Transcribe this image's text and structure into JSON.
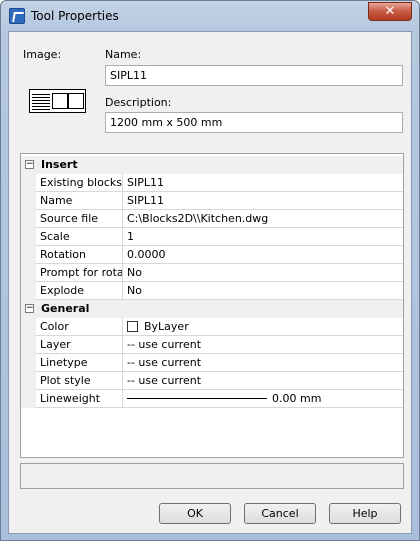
{
  "window": {
    "title": "Tool Properties",
    "close_glyph": "✕"
  },
  "form": {
    "image_label": "Image:",
    "name_label": "Name:",
    "name_value": "SIPL11",
    "description_label": "Description:",
    "description_value": "1200 mm x 500 mm"
  },
  "grid": {
    "categories": [
      {
        "name": "Insert",
        "toggle": "−",
        "rows": [
          {
            "name": "Existing blocks",
            "value": "SIPL11"
          },
          {
            "name": "Name",
            "value": "SIPL11"
          },
          {
            "name": "Source file",
            "value": "C:\\Blocks2D\\\\Kitchen.dwg"
          },
          {
            "name": "Scale",
            "value": "1"
          },
          {
            "name": "Rotation",
            "value": "0.0000"
          },
          {
            "name": "Prompt for rotati",
            "value": "No"
          },
          {
            "name": "Explode",
            "value": "No"
          }
        ]
      },
      {
        "name": "General",
        "toggle": "−",
        "rows": [
          {
            "name": "Color",
            "value": "ByLayer"
          },
          {
            "name": "Layer",
            "value": "-- use current"
          },
          {
            "name": "Linetype",
            "value": "-- use current"
          },
          {
            "name": "Plot style",
            "value": "-- use current"
          },
          {
            "name": "Lineweight",
            "value": "0.00 mm"
          }
        ]
      }
    ]
  },
  "buttons": {
    "ok": "OK",
    "cancel": "Cancel",
    "help": "Help"
  },
  "colors": {
    "title_bar": "#b5c8e0",
    "close_button": "#c75a44",
    "dialog_bg": "#f0f0f0"
  }
}
